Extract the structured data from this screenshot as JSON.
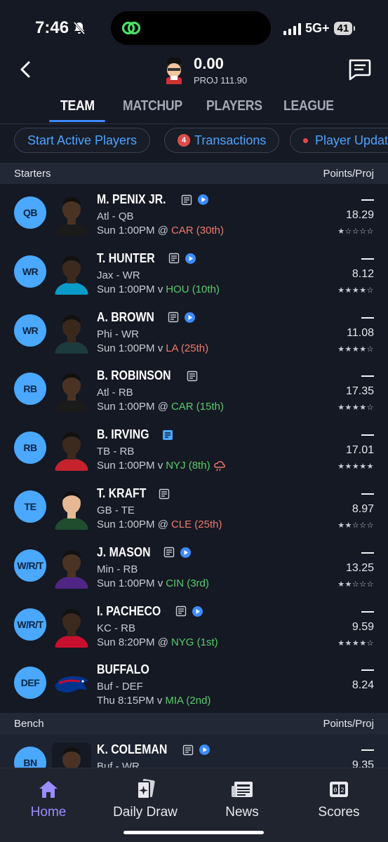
{
  "status_bar": {
    "time": "7:46",
    "network": "5G+",
    "battery": "41"
  },
  "header": {
    "score": "0.00",
    "proj": "PROJ 111.90"
  },
  "tabs": [
    {
      "label": "TEAM"
    },
    {
      "label": "MATCHUP"
    },
    {
      "label": "PLAYERS"
    },
    {
      "label": "LEAGUE"
    }
  ],
  "pills": {
    "start_active": "Start Active Players",
    "transactions_count": "4",
    "transactions": "Transactions",
    "player_updates": "Player Updat"
  },
  "sections": {
    "starters": "Starters",
    "bench": "Bench",
    "points_proj": "Points/Proj"
  },
  "starters": [
    {
      "pos": "QB",
      "name": "M. PENIX JR.",
      "team_pos": "Atl - QB",
      "game_prefix": "Sun 1:00PM @",
      "opp": "CAR (30th)",
      "opp_color": "red",
      "points": "—",
      "proj": "18.29",
      "stars": 1,
      "video": true
    },
    {
      "pos": "WR",
      "name": "T. HUNTER",
      "team_pos": "Jax - WR",
      "game_prefix": "Sun 1:00PM v",
      "opp": "HOU (10th)",
      "opp_color": "green",
      "points": "—",
      "proj": "8.12",
      "stars": 4,
      "video": true
    },
    {
      "pos": "WR",
      "name": "A. BROWN",
      "team_pos": "Phi - WR",
      "game_prefix": "Sun 1:00PM v",
      "opp": "LA (25th)",
      "opp_color": "red",
      "points": "—",
      "proj": "11.08",
      "stars": 4,
      "video": true
    },
    {
      "pos": "RB",
      "name": "B. ROBINSON",
      "team_pos": "Atl - RB",
      "game_prefix": "Sun 1:00PM @",
      "opp": "CAR (15th)",
      "opp_color": "green",
      "points": "—",
      "proj": "17.35",
      "stars": 4,
      "video": false
    },
    {
      "pos": "RB",
      "name": "B. IRVING",
      "team_pos": "TB - RB",
      "game_prefix": "Sun 1:00PM v",
      "opp": "NYJ (8th)",
      "opp_color": "green",
      "points": "—",
      "proj": "17.01",
      "stars": 5,
      "video": false,
      "weather": true,
      "note_blue": true
    },
    {
      "pos": "TE",
      "name": "T. KRAFT",
      "team_pos": "GB - TE",
      "game_prefix": "Sun 1:00PM @",
      "opp": "CLE (25th)",
      "opp_color": "red",
      "points": "—",
      "proj": "8.97",
      "stars": 2,
      "video": false
    },
    {
      "pos": "W/R/T",
      "name": "J. MASON",
      "team_pos": "Min - RB",
      "game_prefix": "Sun 1:00PM v",
      "opp": "CIN (3rd)",
      "opp_color": "green",
      "points": "—",
      "proj": "13.25",
      "stars": 2,
      "video": true
    },
    {
      "pos": "W/R/T",
      "name": "I. PACHECO",
      "team_pos": "KC - RB",
      "game_prefix": "Sun 8:20PM @",
      "opp": "NYG (1st)",
      "opp_color": "green",
      "points": "—",
      "proj": "9.59",
      "stars": 4,
      "video": true
    },
    {
      "pos": "DEF",
      "name": "BUFFALO",
      "team_pos": "Buf - DEF",
      "game_prefix": "Thu 8:15PM v",
      "opp": "MIA (2nd)",
      "opp_color": "green",
      "points": "—",
      "proj": "8.24",
      "stars": 0,
      "video": false,
      "no_note": true
    }
  ],
  "bench": [
    {
      "pos": "BN",
      "name": "K. COLEMAN",
      "team_pos": "Buf - WR",
      "points": "—",
      "proj": "9.35",
      "video": true
    }
  ],
  "bottom_nav": [
    {
      "label": "Home",
      "icon": "home-icon"
    },
    {
      "label": "Daily Draw",
      "icon": "cards-icon"
    },
    {
      "label": "News",
      "icon": "newspaper-icon"
    },
    {
      "label": "Scores",
      "icon": "scoreboard-icon"
    }
  ],
  "colors": {
    "accent": "#4aa8ff",
    "link": "#4da3ff",
    "bad": "#f07a6e",
    "good": "#58cc6b",
    "nav_active": "#9b8cff",
    "background": "#151923"
  }
}
